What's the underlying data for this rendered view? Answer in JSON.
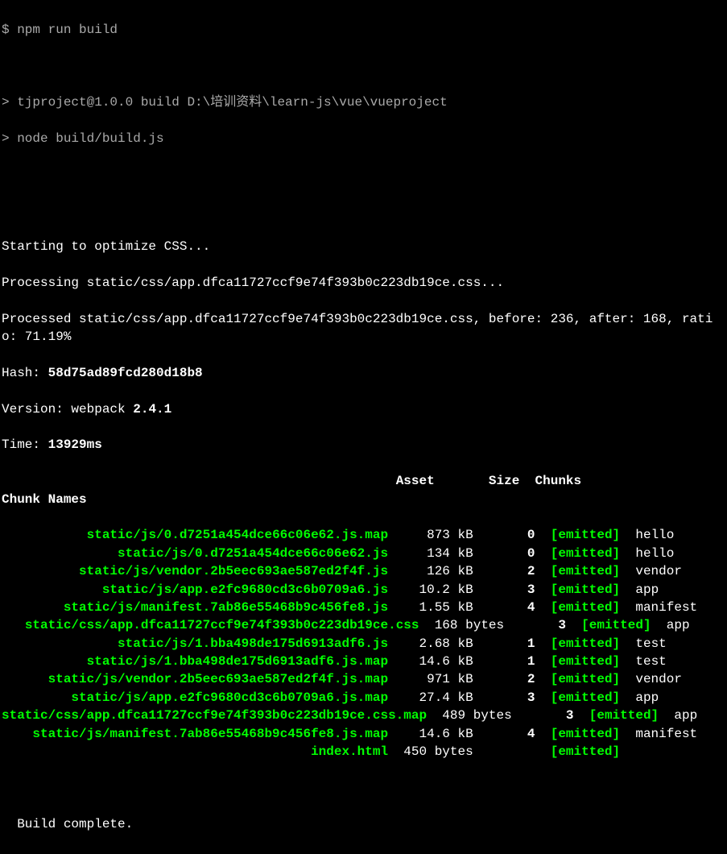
{
  "prompt": "$ npm run build",
  "header1": "> tjproject@1.0.0 build D:\\培训资料\\learn-js\\vue\\vueproject",
  "header2": "> node build/build.js",
  "opt1": "Starting to optimize CSS...",
  "opt2": "Processing static/css/app.dfca11727ccf9e74f393b0c223db19ce.css...",
  "opt3": "Processed static/css/app.dfca11727ccf9e74f393b0c223db19ce.css, before: 236, after: 168, ratio: 71.19%",
  "hashLabel": "Hash: ",
  "hashValue": "58d75ad89fcd280d18b8",
  "versionLabel": "Version: webpack ",
  "versionValue": "2.4.1",
  "timeLabel": "Time: ",
  "timeValue": "13929ms",
  "colHeader1": "                                                   Asset       Size  Chunks                    Chunk Names",
  "rows": [
    {
      "asset": "           static/js/0.d7251a454dce66c06e62.js.map",
      "size": "     873 kB",
      "chunks": "       0  ",
      "flag": "[emitted]",
      "name": "  hello"
    },
    {
      "asset": "               static/js/0.d7251a454dce66c06e62.js",
      "size": "     134 kB",
      "chunks": "       0  ",
      "flag": "[emitted]",
      "name": "  hello"
    },
    {
      "asset": "          static/js/vendor.2b5eec693ae587ed2f4f.js",
      "size": "     126 kB",
      "chunks": "       2  ",
      "flag": "[emitted]",
      "name": "  vendor"
    },
    {
      "asset": "             static/js/app.e2fc9680cd3c6b0709a6.js",
      "size": "    10.2 kB",
      "chunks": "       3  ",
      "flag": "[emitted]",
      "name": "  app"
    },
    {
      "asset": "        static/js/manifest.7ab86e55468b9c456fe8.js",
      "size": "    1.55 kB",
      "chunks": "       4  ",
      "flag": "[emitted]",
      "name": "  manifest"
    },
    {
      "asset": "   static/css/app.dfca11727ccf9e74f393b0c223db19ce.css",
      "size": "  168 bytes",
      "chunks": "       3  ",
      "flag": "[emitted]",
      "name": "  app"
    },
    {
      "asset": "               static/js/1.bba498de175d6913adf6.js",
      "size": "    2.68 kB",
      "chunks": "       1  ",
      "flag": "[emitted]",
      "name": "  test"
    },
    {
      "asset": "           static/js/1.bba498de175d6913adf6.js.map",
      "size": "    14.6 kB",
      "chunks": "       1  ",
      "flag": "[emitted]",
      "name": "  test"
    },
    {
      "asset": "      static/js/vendor.2b5eec693ae587ed2f4f.js.map",
      "size": "     971 kB",
      "chunks": "       2  ",
      "flag": "[emitted]",
      "name": "  vendor"
    },
    {
      "asset": "         static/js/app.e2fc9680cd3c6b0709a6.js.map",
      "size": "    27.4 kB",
      "chunks": "       3  ",
      "flag": "[emitted]",
      "name": "  app"
    },
    {
      "asset": "static/css/app.dfca11727ccf9e74f393b0c223db19ce.css.map",
      "size": "  489 bytes",
      "chunks": "       3  ",
      "flag": "[emitted]",
      "name": "  app"
    },
    {
      "asset": "    static/js/manifest.7ab86e55468b9c456fe8.js.map",
      "size": "    14.6 kB",
      "chunks": "       4  ",
      "flag": "[emitted]",
      "name": "  manifest"
    },
    {
      "asset": "                                        index.html",
      "size": "  450 bytes",
      "chunks": "          ",
      "flag": "[emitted]",
      "name": ""
    }
  ],
  "complete": "  Build complete."
}
